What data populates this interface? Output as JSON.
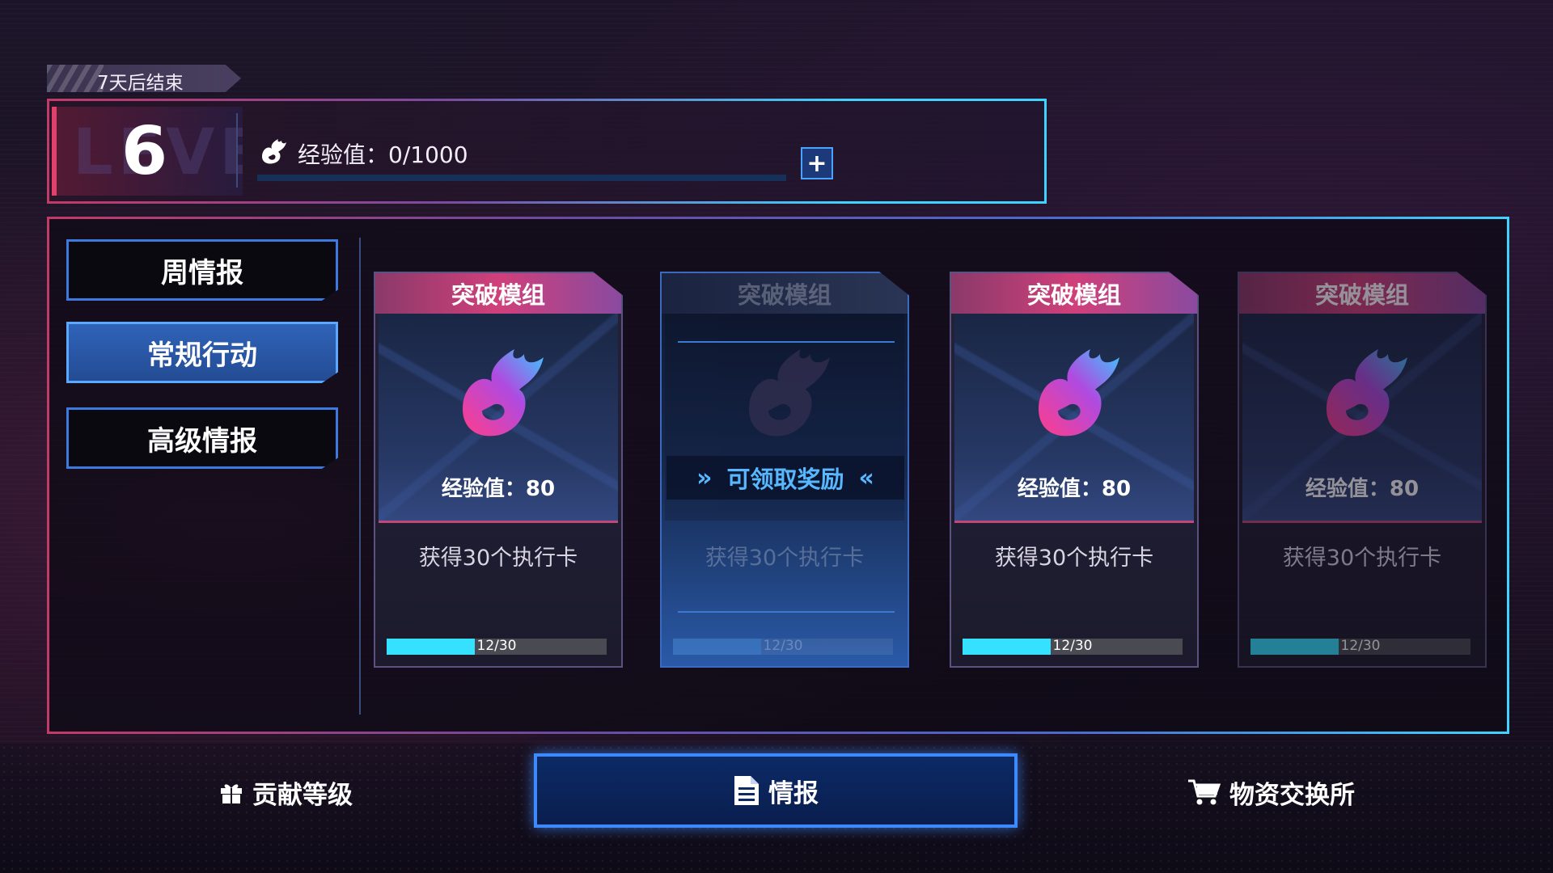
{
  "header": {
    "countdown": "7天后结束",
    "level_ghost": "LEVEL",
    "level": "6",
    "xp_label": "经验值：0/1000",
    "xp_progress": 0,
    "plus_label": "+"
  },
  "sidebar": {
    "items": [
      {
        "label": "周情报",
        "active": false
      },
      {
        "label": "常规行动",
        "active": true
      },
      {
        "label": "高级情报",
        "active": false
      }
    ]
  },
  "cards": [
    {
      "title": "突破模组",
      "xp": "经验值：80",
      "desc": "获得30个执行卡",
      "progress_text": "12/30",
      "progress": 0.4,
      "state": "normal"
    },
    {
      "title": "突破模组",
      "claim_label": "可领取奖励",
      "desc": "获得30个执行卡",
      "progress_text": "12/30",
      "progress": 0.4,
      "state": "claimable"
    },
    {
      "title": "突破模组",
      "xp": "经验值：80",
      "desc": "获得30个执行卡",
      "progress_text": "12/30",
      "progress": 0.4,
      "state": "normal"
    },
    {
      "title": "突破模组",
      "xp": "经验值：80",
      "desc": "获得30个执行卡",
      "progress_text": "12/30",
      "progress": 0.4,
      "state": "dim"
    }
  ],
  "bottom_nav": {
    "contribution": "贡献等级",
    "intel": "情报",
    "exchange": "物资交换所"
  },
  "colors": {
    "accent_cyan": "#36e0ff",
    "accent_pink": "#d0407a",
    "accent_blue": "#3d8aff"
  },
  "icons": [
    "flame-icon",
    "plus-icon",
    "gift-icon",
    "document-icon",
    "cart-icon",
    "double-chevron-right-icon",
    "double-chevron-left-icon"
  ]
}
